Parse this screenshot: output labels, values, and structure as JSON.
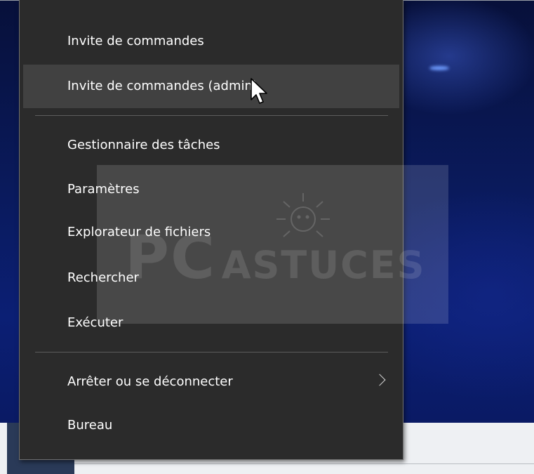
{
  "menu": {
    "items": [
      {
        "label": "Invite de commandes"
      },
      {
        "label": "Invite de commandes (admin)"
      },
      {
        "label": "Gestionnaire des tâches"
      },
      {
        "label": "Paramètres"
      },
      {
        "label": "Explorateur de fichiers"
      },
      {
        "label": "Rechercher"
      },
      {
        "label": "Exécuter"
      },
      {
        "label": "Arrêter ou se déconnecter",
        "submenu": true
      },
      {
        "label": "Bureau"
      }
    ],
    "hovered_item": "Invite de commandes (admin)",
    "colors": {
      "background": "#2b2b2b",
      "highlight": "#414141",
      "text": "#ffffff"
    }
  },
  "watermark": {
    "brand_pc": "PC",
    "brand_astuces": "ASTUCES"
  },
  "icons": {
    "submenu_arrow": "chevron-right-icon",
    "pointer": "mouse-cursor-icon"
  }
}
